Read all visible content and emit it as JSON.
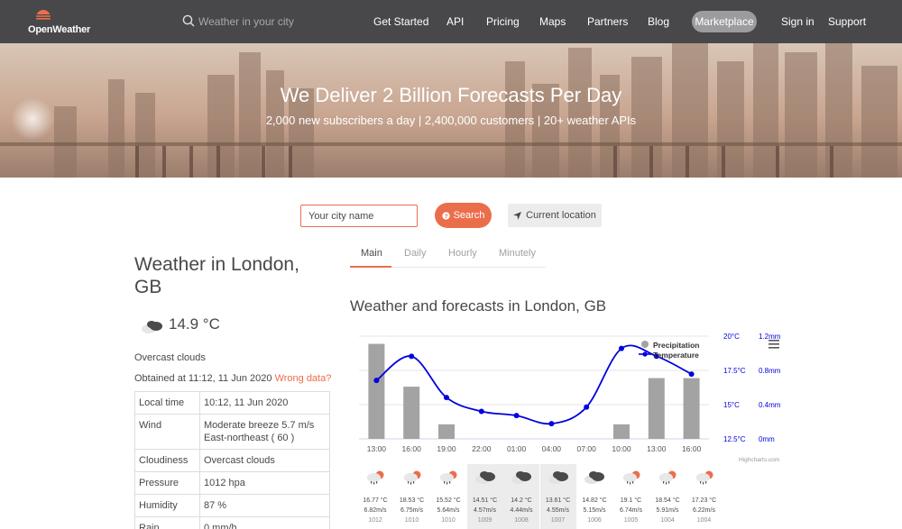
{
  "brand": {
    "name": "OpenWeather",
    "accent": "#eb6e4b",
    "header_bg": "#48484a"
  },
  "header": {
    "search_placeholder": "Weather in your city",
    "nav": [
      "Get Started",
      "API",
      "Pricing",
      "Maps",
      "Partners",
      "Blog"
    ],
    "marketplace": "Marketplace",
    "sign_in": "Sign in",
    "support": "Support"
  },
  "hero": {
    "title": "We Deliver 2 Billion Forecasts Per Day",
    "subtitle": "2,000 new subscribers a day | 2,400,000 customers | 20+ weather APIs"
  },
  "search": {
    "placeholder": "Your city name",
    "button": "Search",
    "location_button": "Current location"
  },
  "current": {
    "title": "Weather in London, GB",
    "temperature": "14.9 °C",
    "description": "Overcast clouds",
    "obtained": "Obtained at 11:12, 11 Jun 2020",
    "wrong_data": "Wrong data?",
    "table": [
      {
        "label": "Local time",
        "value": "10:12, 11 Jun 2020"
      },
      {
        "label": "Wind",
        "value": "Moderate breeze 5.7 m/s East-northeast ( 60 )"
      },
      {
        "label": "Cloudiness",
        "value": "Overcast clouds"
      },
      {
        "label": "Pressure",
        "value": "1012 hpa"
      },
      {
        "label": "Humidity",
        "value": "87 %"
      },
      {
        "label": "Rain",
        "value": "0 mm/h"
      }
    ]
  },
  "tabs": [
    "Main",
    "Daily",
    "Hourly",
    "Minutely"
  ],
  "forecast_title": "Weather and forecasts in London, GB",
  "chart_data": {
    "type": "bar",
    "categories": [
      "13:00",
      "16:00",
      "19:00",
      "22:00",
      "01:00",
      "04:00",
      "07:00",
      "10:00",
      "13:00",
      "16:00"
    ],
    "series": [
      {
        "name": "Precipitation",
        "type": "bar",
        "axis": "right",
        "color": "#a3a3a3",
        "values": [
          1.11,
          0.61,
          0.17,
          0,
          0,
          0,
          0,
          0.17,
          0.71,
          0.71
        ]
      },
      {
        "name": "Temperature",
        "type": "line",
        "axis": "left",
        "color": "#0000dd",
        "values": [
          16.77,
          18.53,
          15.52,
          14.51,
          14.2,
          13.61,
          14.82,
          19.1,
          18.54,
          17.23
        ]
      }
    ],
    "y_left": {
      "ticks": [
        "20°C",
        "17.5°C",
        "15°C",
        "12.5°C"
      ],
      "min": 12.5,
      "max": 20
    },
    "y_right": {
      "ticks": [
        "1.2mm",
        "0.8mm",
        "0.4mm",
        "0mm"
      ],
      "min": 0,
      "max": 1.2
    },
    "credit": "Highcharts.com",
    "legend": "top-right"
  },
  "days": [
    {
      "temp": "16.77 °C",
      "wind": "6.82m/s",
      "pressure": "1012",
      "icon": "rain-sun-icon",
      "shaded": false
    },
    {
      "temp": "18.53 °C",
      "wind": "6.75m/s",
      "pressure": "1010",
      "icon": "rain-sun-icon",
      "shaded": false
    },
    {
      "temp": "15.52 °C",
      "wind": "5.64m/s",
      "pressure": "1010",
      "icon": "rain-sun-icon",
      "shaded": false
    },
    {
      "temp": "14.51 °C",
      "wind": "4.57m/s",
      "pressure": "1009",
      "icon": "overcast-cloud-icon",
      "shaded": true
    },
    {
      "temp": "14.2 °C",
      "wind": "4.44m/s",
      "pressure": "1008",
      "icon": "overcast-cloud-icon",
      "shaded": true
    },
    {
      "temp": "13.61 °C",
      "wind": "4.55m/s",
      "pressure": "1007",
      "icon": "overcast-cloud-icon",
      "shaded": true
    },
    {
      "temp": "14.82 °C",
      "wind": "5.15m/s",
      "pressure": "1006",
      "icon": "overcast-cloud-icon",
      "shaded": false
    },
    {
      "temp": "19.1 °C",
      "wind": "6.74m/s",
      "pressure": "1005",
      "icon": "rain-sun-icon",
      "shaded": false
    },
    {
      "temp": "18.54 °C",
      "wind": "5.91m/s",
      "pressure": "1004",
      "icon": "rain-sun-icon",
      "shaded": false
    },
    {
      "temp": "17.23 °C",
      "wind": "6.22m/s",
      "pressure": "1004",
      "icon": "rain-sun-icon",
      "shaded": false
    }
  ]
}
